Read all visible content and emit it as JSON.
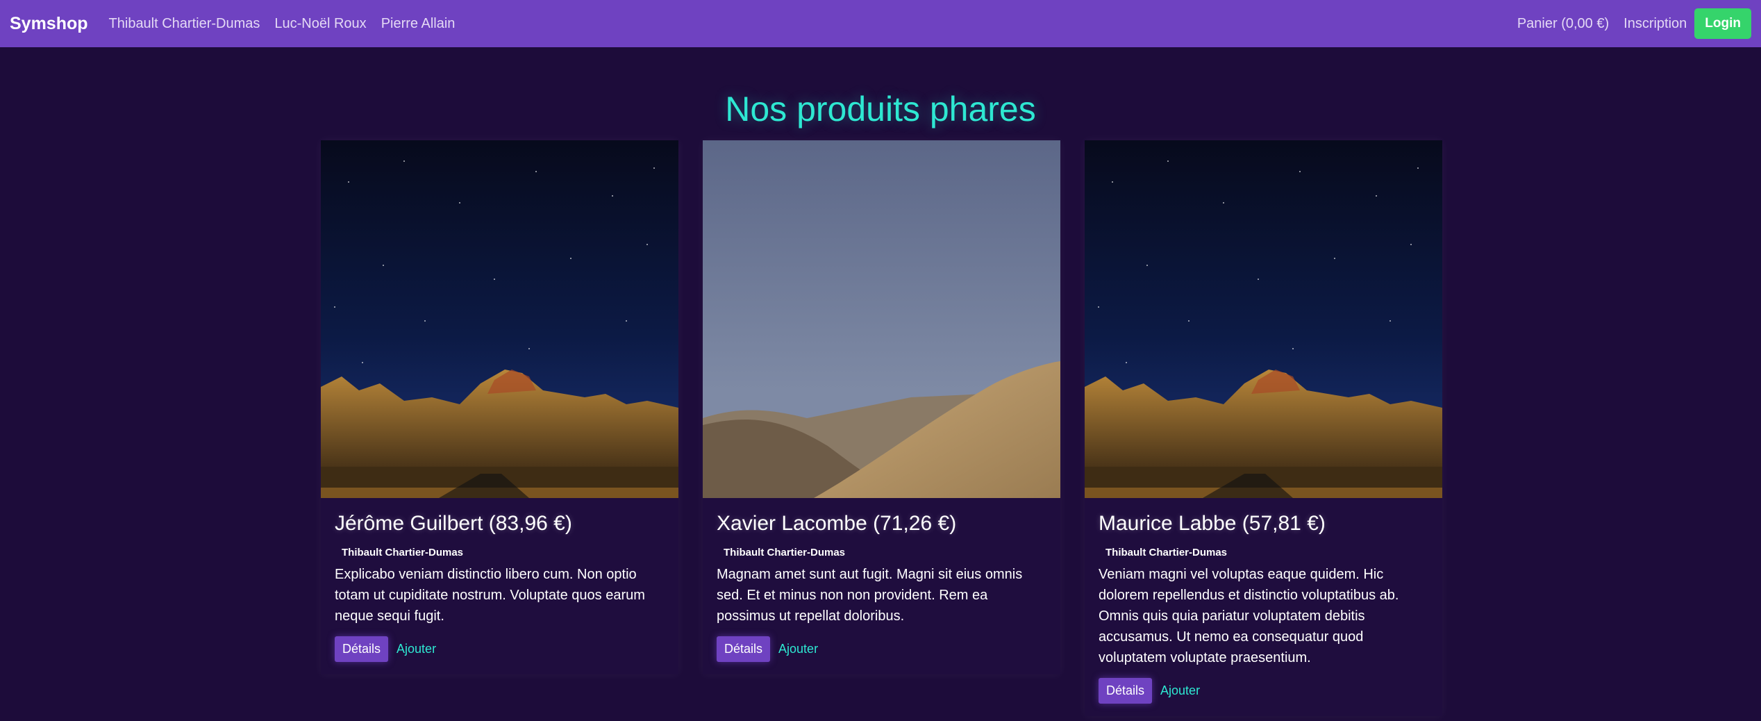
{
  "navbar": {
    "brand": "Symshop",
    "links": [
      "Thibault Chartier-Dumas",
      "Luc-Noël Roux",
      "Pierre Allain"
    ],
    "cart": "Panier (0,00 €)",
    "signup": "Inscription",
    "login": "Login",
    "color": "#6f42c1",
    "login_color": "#35d46b"
  },
  "main": {
    "title": "Nos produits phares",
    "title_color": "#2ee8d2",
    "background": "#1d0c3a"
  },
  "products": [
    {
      "image": "desert-mountains-night-sky",
      "title": "Jérôme Guilbert (83,96 €)",
      "category": "Thibault Chartier-Dumas",
      "description": "Explicabo veniam distinctio libero cum. Non optio totam ut cupiditate nostrum. Voluptate quos earum neque sequi fugit.",
      "details_label": "Détails",
      "add_label": "Ajouter"
    },
    {
      "image": "sand-dunes-dusk",
      "title": "Xavier Lacombe (71,26 €)",
      "category": "Thibault Chartier-Dumas",
      "description": "Magnam amet sunt aut fugit. Magni sit eius omnis sed. Et et minus non non provident. Rem ea possimus ut repellat doloribus.",
      "details_label": "Détails",
      "add_label": "Ajouter"
    },
    {
      "image": "desert-mountains-night-sky",
      "title": "Maurice Labbe (57,81 €)",
      "category": "Thibault Chartier-Dumas",
      "description": "Veniam magni vel voluptas eaque quidem. Hic dolorem repellendus et distinctio voluptatibus ab. Omnis quis quia pariatur voluptatem debitis accusamus. Ut nemo ea consequatur quod voluptatem voluptate praesentium.",
      "details_label": "Détails",
      "add_label": "Ajouter"
    }
  ]
}
